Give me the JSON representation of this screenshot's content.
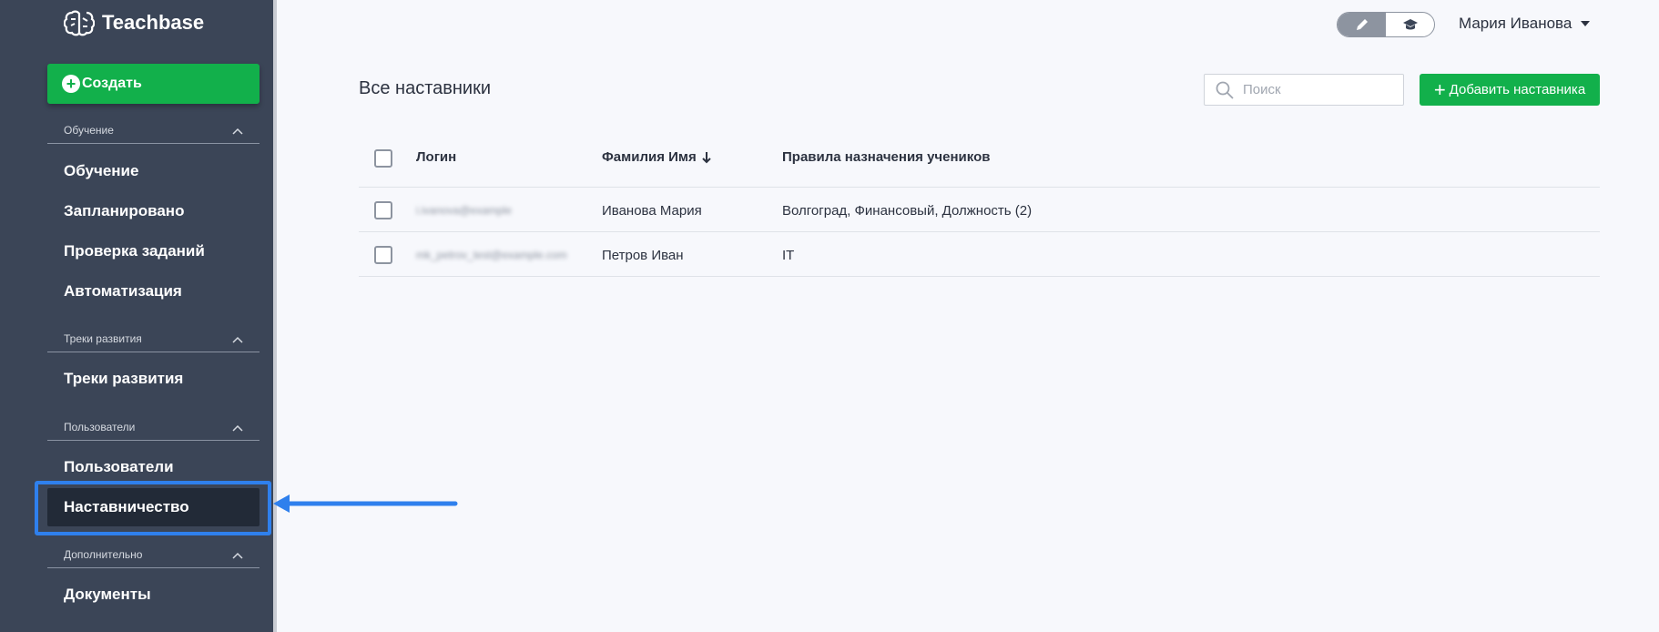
{
  "app": {
    "brand": "Teachbase"
  },
  "sidebar": {
    "create_label": "Создать",
    "sections": [
      {
        "title": "Обучение",
        "items": [
          "Обучение",
          "Запланировано",
          "Проверка заданий",
          "Автоматизация"
        ]
      },
      {
        "title": "Треки развития",
        "items": [
          "Треки развития"
        ]
      },
      {
        "title": "Пользователи",
        "items": [
          "Пользователи",
          "Наставничество"
        ]
      },
      {
        "title": "Дополнительно",
        "items": [
          "Документы"
        ]
      }
    ],
    "active_item": "Наставничество"
  },
  "header": {
    "user_name": "Мария Иванова"
  },
  "main": {
    "title": "Все наставники",
    "search_placeholder": "Поиск",
    "add_button": "Добавить наставника",
    "columns": {
      "login": "Логин",
      "name": "Фамилия Имя",
      "rules": "Правила назначения учеников"
    },
    "rows": [
      {
        "login": "i.ivanova@example",
        "name": "Иванова Мария",
        "rules": "Волгоград, Финансовый, Должность (2)"
      },
      {
        "login": "mk_petrov_test@example.com",
        "name": "Петров Иван",
        "rules": "IT"
      }
    ]
  },
  "colors": {
    "sidebar_bg": "#3b4557",
    "accent_green": "#12b04b",
    "highlight_blue": "#2f80ed",
    "active_item_bg": "#222a37"
  }
}
